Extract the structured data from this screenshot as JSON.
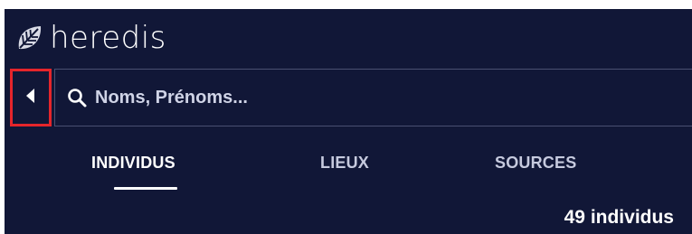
{
  "app": {
    "logo_text": "heredis",
    "logo_icon": "leaf-icon"
  },
  "search": {
    "placeholder": "Noms, Prénoms...",
    "value": "",
    "icon": "search-icon",
    "collapse_icon": "triangle-left-icon"
  },
  "tabs": [
    {
      "label": "INDIVIDUS",
      "active": true
    },
    {
      "label": "LIEUX",
      "active": false
    },
    {
      "label": "SOURCES",
      "active": false
    }
  ],
  "results": {
    "count_label": "49 individus"
  },
  "colors": {
    "background": "#111737",
    "highlight": "#e5252b",
    "text": "#ffffff"
  }
}
